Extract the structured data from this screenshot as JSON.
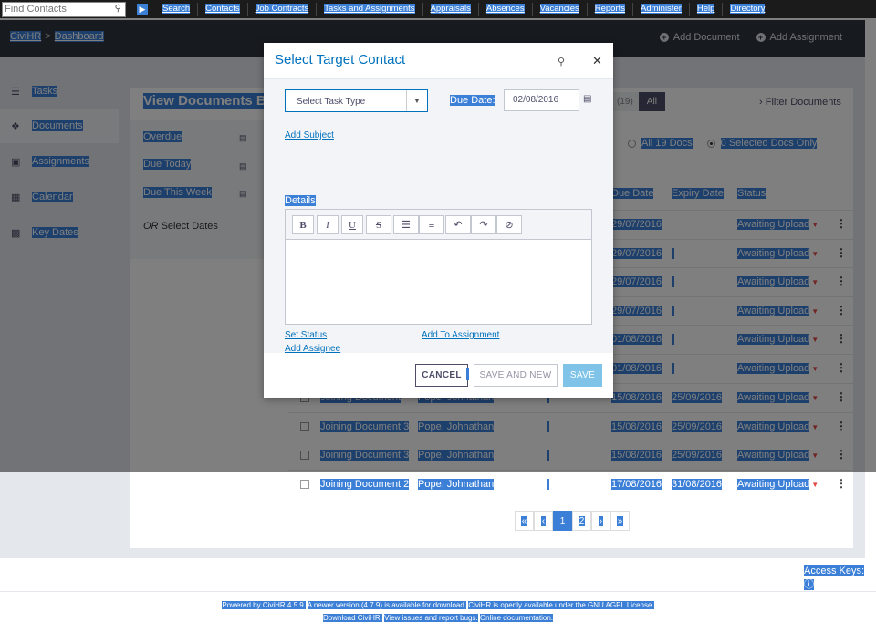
{
  "menubar": {
    "find_placeholder": "Find Contacts",
    "items": [
      "Search",
      "Contacts",
      "Job Contracts",
      "Tasks and Assignments",
      "Appraisals",
      "Absences",
      "Vacancies",
      "Reports",
      "Administer",
      "Help",
      "Directory"
    ]
  },
  "header": {
    "breadcrumb": [
      "CiviHR",
      "Dashboard"
    ],
    "add_document": "Add Document",
    "add_assignment": "Add Assignment"
  },
  "sidebar": {
    "items": [
      {
        "label": "Tasks",
        "icon": "list-icon"
      },
      {
        "label": "Documents",
        "icon": "document-icon"
      },
      {
        "label": "Assignments",
        "icon": "briefcase-icon"
      },
      {
        "label": "Calendar",
        "icon": "calendar-icon"
      },
      {
        "label": "Key Dates",
        "icon": "chart-icon"
      }
    ]
  },
  "documents": {
    "title": "View Documents By",
    "filters": [
      "Overdue",
      "Due Today",
      "Due This Week"
    ],
    "or_select": "Select Dates",
    "or_prefix": "OR",
    "count_tab": "(19)",
    "all_tab": "All",
    "filter_docs": "Filter Documents",
    "radio_all": "All 19 Docs",
    "radio_selected": "0 Selected Docs Only",
    "columns": [
      "Due Date",
      "Expiry Date",
      "Status"
    ],
    "rows": [
      {
        "name": "",
        "contact": "",
        "due": "29/07/2016",
        "expiry": "",
        "status": "Awaiting Upload"
      },
      {
        "name": "",
        "contact": "",
        "due": "29/07/2016",
        "expiry": "",
        "status": "Awaiting Upload"
      },
      {
        "name": "",
        "contact": "",
        "due": "29/07/2016",
        "expiry": "",
        "status": "Awaiting Upload"
      },
      {
        "name": "",
        "contact": "",
        "due": "29/07/2016",
        "expiry": "",
        "status": "Awaiting Upload"
      },
      {
        "name": "",
        "contact": "",
        "due": "01/08/2016",
        "expiry": "",
        "status": "Awaiting Upload"
      },
      {
        "name": "",
        "contact": "",
        "due": "01/08/2016",
        "expiry": "",
        "status": "Awaiting Upload"
      },
      {
        "name": "Joining Document",
        "contact": "Pope, Johnathan",
        "due": "15/08/2016",
        "expiry": "25/09/2016",
        "status": "Awaiting Upload"
      },
      {
        "name": "Joining Document 3",
        "contact": "Pope, Johnathan",
        "due": "15/08/2016",
        "expiry": "25/09/2016",
        "status": "Awaiting Upload"
      },
      {
        "name": "Joining Document 3",
        "contact": "Pope, Johnathan",
        "due": "15/08/2016",
        "expiry": "25/09/2016",
        "status": "Awaiting Upload"
      },
      {
        "name": "Joining Document 2",
        "contact": "Pope, Johnathan",
        "due": "17/08/2016",
        "expiry": "31/08/2016",
        "status": "Awaiting Upload"
      }
    ],
    "pager": [
      "«",
      "‹",
      "1",
      "2",
      "›",
      "»"
    ],
    "current_page": "1"
  },
  "modal": {
    "title": "Select Target Contact",
    "task_type_placeholder": "Select Task Type",
    "due_label": "Due Date:",
    "due_value": "02/08/2016",
    "add_subject": "Add Subject",
    "details_label": "Details",
    "toolbar": [
      "B",
      "I",
      "U",
      "S",
      "bulleted-list",
      "numbered-list",
      "undo",
      "redo",
      "clear"
    ],
    "add_assignee": "Add Assignee",
    "set_status": "Set Status",
    "add_to_assignment": "Add To Assignment",
    "cancel": "CANCEL",
    "save_and_new": "SAVE AND NEW",
    "save": "SAVE"
  },
  "footer": {
    "access_keys": "Access Keys:",
    "line1": [
      "Powered by CiviHR 4.5.9.",
      "A newer version (4.7.9) is available for download.",
      "CiviHR is openly available under the GNU AGPL License."
    ],
    "line2": [
      "Download CiviHR.",
      "View issues and report bugs.",
      "Online documentation."
    ]
  },
  "colors": {
    "highlight": "#3b7fd6",
    "accent": "#0071bd",
    "header_dark": "#2f353f",
    "status_caret": "#e14b4b"
  }
}
